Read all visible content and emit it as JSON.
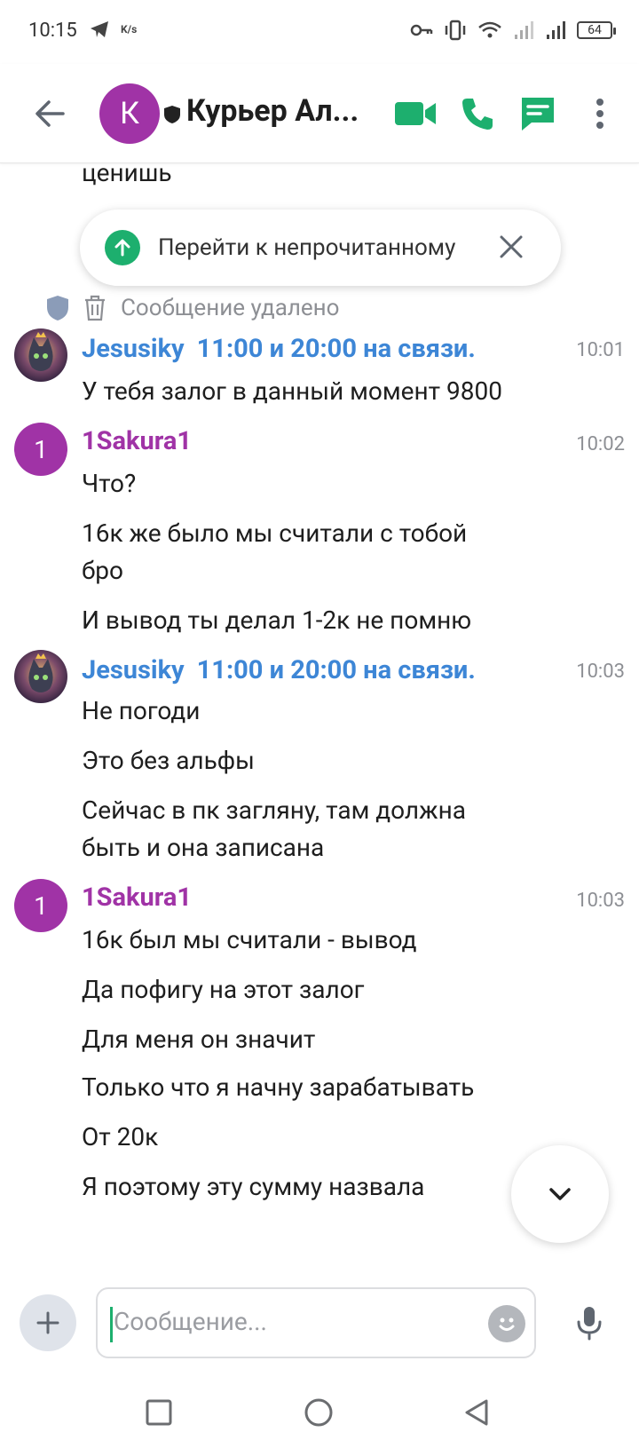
{
  "status_bar": {
    "time": "10:15",
    "signal_label": "K/s",
    "battery": "64"
  },
  "header": {
    "avatar_letter": "К",
    "title": "Курьер Ал..."
  },
  "unread_pill": {
    "label": "Перейти к непрочитанному"
  },
  "top_partial": {
    "line1": "ценишь"
  },
  "deleted_message": "Сообщение удалено",
  "messages": [
    {
      "sender": "Jesusiky",
      "status": "11:00 и 20:00 на связи.",
      "time": "10:01",
      "lines": [
        "У тебя залог в данный момент 9800"
      ]
    },
    {
      "sender": "1Sakura1",
      "avatar_letter": "1",
      "time": "10:02",
      "lines": [
        "Что?",
        "16к же было мы считали с тобой бро",
        "И вывод ты делал 1-2к не помню"
      ]
    },
    {
      "sender": "Jesusiky",
      "status": "11:00 и 20:00 на связи.",
      "time": "10:03",
      "lines": [
        "Не погоди",
        "Это без альфы",
        "Сейчас в пк загляну, там должна быть и она записана"
      ]
    },
    {
      "sender": "1Sakura1",
      "avatar_letter": "1",
      "time": "10:03",
      "lines": [
        "16к был мы считали - вывод",
        "Да пофигу на этот залог",
        "Для меня он значит",
        "Только что я начну зарабатывать",
        "От 20к",
        "Я поэтому эту сумму назвала"
      ]
    }
  ],
  "composer": {
    "placeholder": "Сообщение..."
  },
  "colors": {
    "accent_green": "#1daf6e",
    "purple": "#a033a6",
    "blue": "#3d86d6"
  }
}
